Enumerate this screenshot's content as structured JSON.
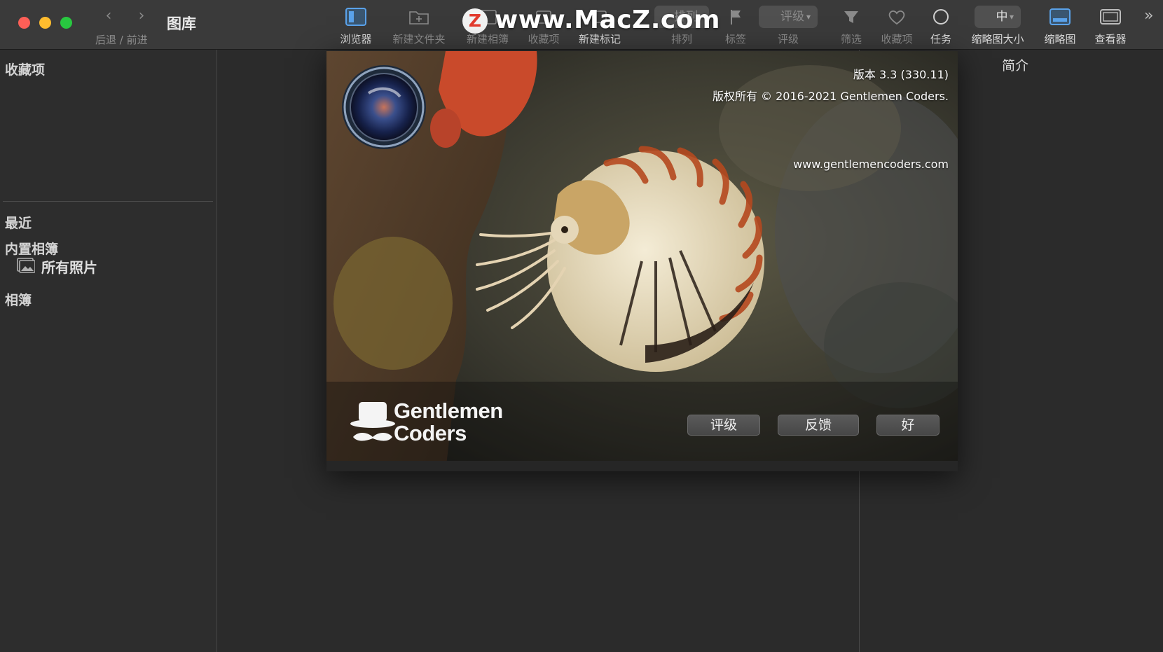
{
  "window": {
    "title": "图库"
  },
  "watermark": {
    "badge": "Z",
    "text": "www.MacZ.com"
  },
  "nav": {
    "back_glyph": "‹",
    "forward_glyph": "›",
    "label": "后退 / 前进"
  },
  "toolbar": {
    "browser": "浏览器",
    "new_folder": "新建文件夹",
    "new_album": "新建相簿",
    "favorites": "收藏项",
    "new_tag": "新建标记",
    "sort_pill": "排列",
    "sort": "排列",
    "label": "标签",
    "rating_pill": "评级",
    "rating": "评级",
    "filter": "筛选",
    "favorites2": "收藏项",
    "tasks": "任务",
    "thumb_size_pill": "中",
    "thumb_size": "缩略图大小",
    "thumbnails": "缩略图",
    "viewer": "查看器",
    "overflow_glyph": "»"
  },
  "sidebar": {
    "favorites_header": "收藏项",
    "recent": "最近",
    "builtin_albums": "内置相簿",
    "all_photos": "所有照片",
    "albums": "相簿"
  },
  "inspector": {
    "title": "简介"
  },
  "about": {
    "version": "版本 3.3 (330.11)",
    "copyright": "版权所有 © 2016-2021 Gentlemen Coders.",
    "url": "www.gentlemencoders.com",
    "logo_line1": "Gentlemen",
    "logo_line2": "Coders",
    "rate_button": "评级",
    "feedback_button": "反馈",
    "ok_button": "好"
  },
  "colors": {
    "accent": "#3d8bd8",
    "toolbar_bg": "#3a3a3a",
    "sidebar_bg": "#2d2d2d",
    "close": "#fe5f57",
    "minimize": "#febc2e",
    "maximize": "#28c840"
  }
}
